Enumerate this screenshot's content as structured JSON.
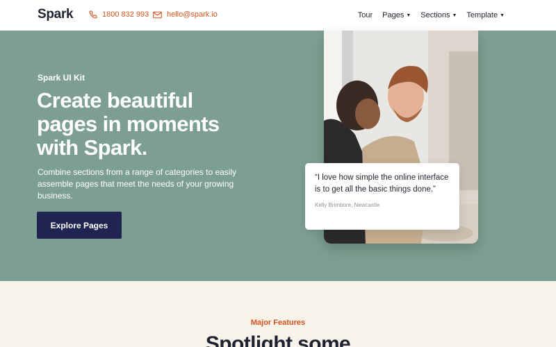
{
  "header": {
    "logo": "Spark",
    "phone": "1800 832 993",
    "email": "hello@spark.io",
    "nav": [
      {
        "label": "Tour",
        "dropdown": false
      },
      {
        "label": "Pages",
        "dropdown": true
      },
      {
        "label": "Sections",
        "dropdown": true
      },
      {
        "label": "Template",
        "dropdown": true
      }
    ]
  },
  "hero": {
    "kicker": "Spark UI Kit",
    "headline": "Create beautiful pages in moments with Spark.",
    "lede": "Combine sections from a range of categories to easily assemble pages that meet the needs of your growing business.",
    "cta_label": "Explore Pages",
    "quote": {
      "text": "“I love how simple the online interface is to get all the basic things done.”",
      "author": "Kelly Brimbore, Newcastle"
    }
  },
  "features": {
    "kicker": "Major Features",
    "title": "Spotlight some"
  },
  "colors": {
    "hero_bg": "#7d9f91",
    "accent": "#d4521d",
    "button_bg": "#1f2550",
    "section_bg": "#f7f2ea"
  },
  "icons": {
    "phone": "phone-icon",
    "email": "envelope-icon",
    "dropdown": "caret-down-icon"
  }
}
